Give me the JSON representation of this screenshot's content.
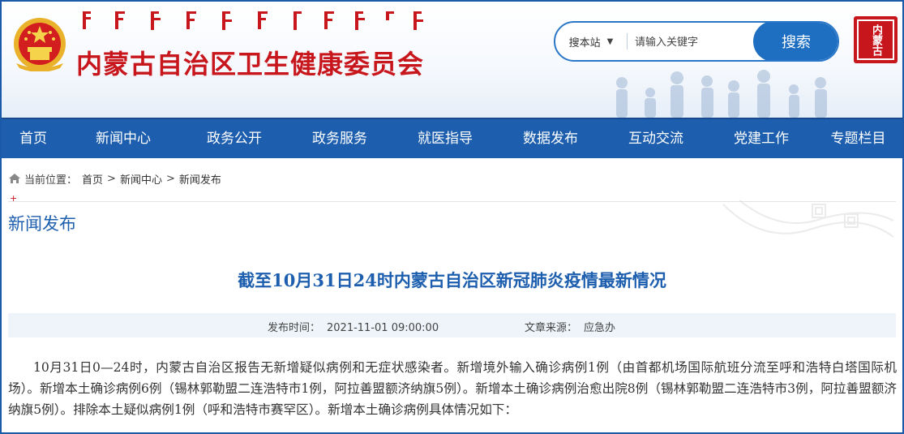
{
  "header": {
    "site_title": "内蒙古自治区卫生健康委员会",
    "mongolian_script_text": "ᠥᠪᠦᠷ ᠮᠣᠩᠭᠣᠯ ᠤᠨ ᠡᠷᠡᠭᠦᠯ ᠮᠡᠨᠳᠦ",
    "seal_text": "内蒙古"
  },
  "search": {
    "scope_label": "搜本站",
    "placeholder": "请输入关键字",
    "button_label": "搜索"
  },
  "nav": {
    "items": [
      {
        "label": "首页"
      },
      {
        "label": "新闻中心"
      },
      {
        "label": "政务公开"
      },
      {
        "label": "政务服务"
      },
      {
        "label": "就医指导"
      },
      {
        "label": "数据发布"
      },
      {
        "label": "互动交流"
      },
      {
        "label": "党建工作"
      },
      {
        "label": "专题栏目"
      }
    ]
  },
  "breadcrumb": {
    "prefix": "当前位置：",
    "items": [
      "首页",
      "新闻中心",
      "新闻发布"
    ],
    "separator": ">"
  },
  "section": {
    "title": "新闻发布",
    "marker": "+"
  },
  "article": {
    "title": "截至10月31日24时内蒙古自治区新冠肺炎疫情最新情况",
    "publish_label": "发布时间：",
    "publish_time": "2021-11-01 09:00:00",
    "source_label": "文章来源：",
    "source": "应急办",
    "body": "10月31日0—24时，内蒙古自治区报告无新增疑似病例和无症状感染者。新增境外输入确诊病例1例（由首都机场国际航班分流至呼和浩特白塔国际机场）。新增本土确诊病例6例（锡林郭勒盟二连浩特市1例，阿拉善盟额济纳旗5例）。新增本土确诊病例治愈出院8例（锡林郭勒盟二连浩特市3例，阿拉善盟额济纳旗5例）。排除本土疑似病例1例（呼和浩特市赛罕区）。新增本土确诊病例具体情况如下："
  },
  "colors": {
    "brand_blue": "#1d5fae",
    "title_red": "#c8161d",
    "meta_bg": "#eef4fa"
  },
  "icons": [
    "national-emblem-icon",
    "home-icon",
    "chevron-down-icon",
    "seal-logo"
  ]
}
